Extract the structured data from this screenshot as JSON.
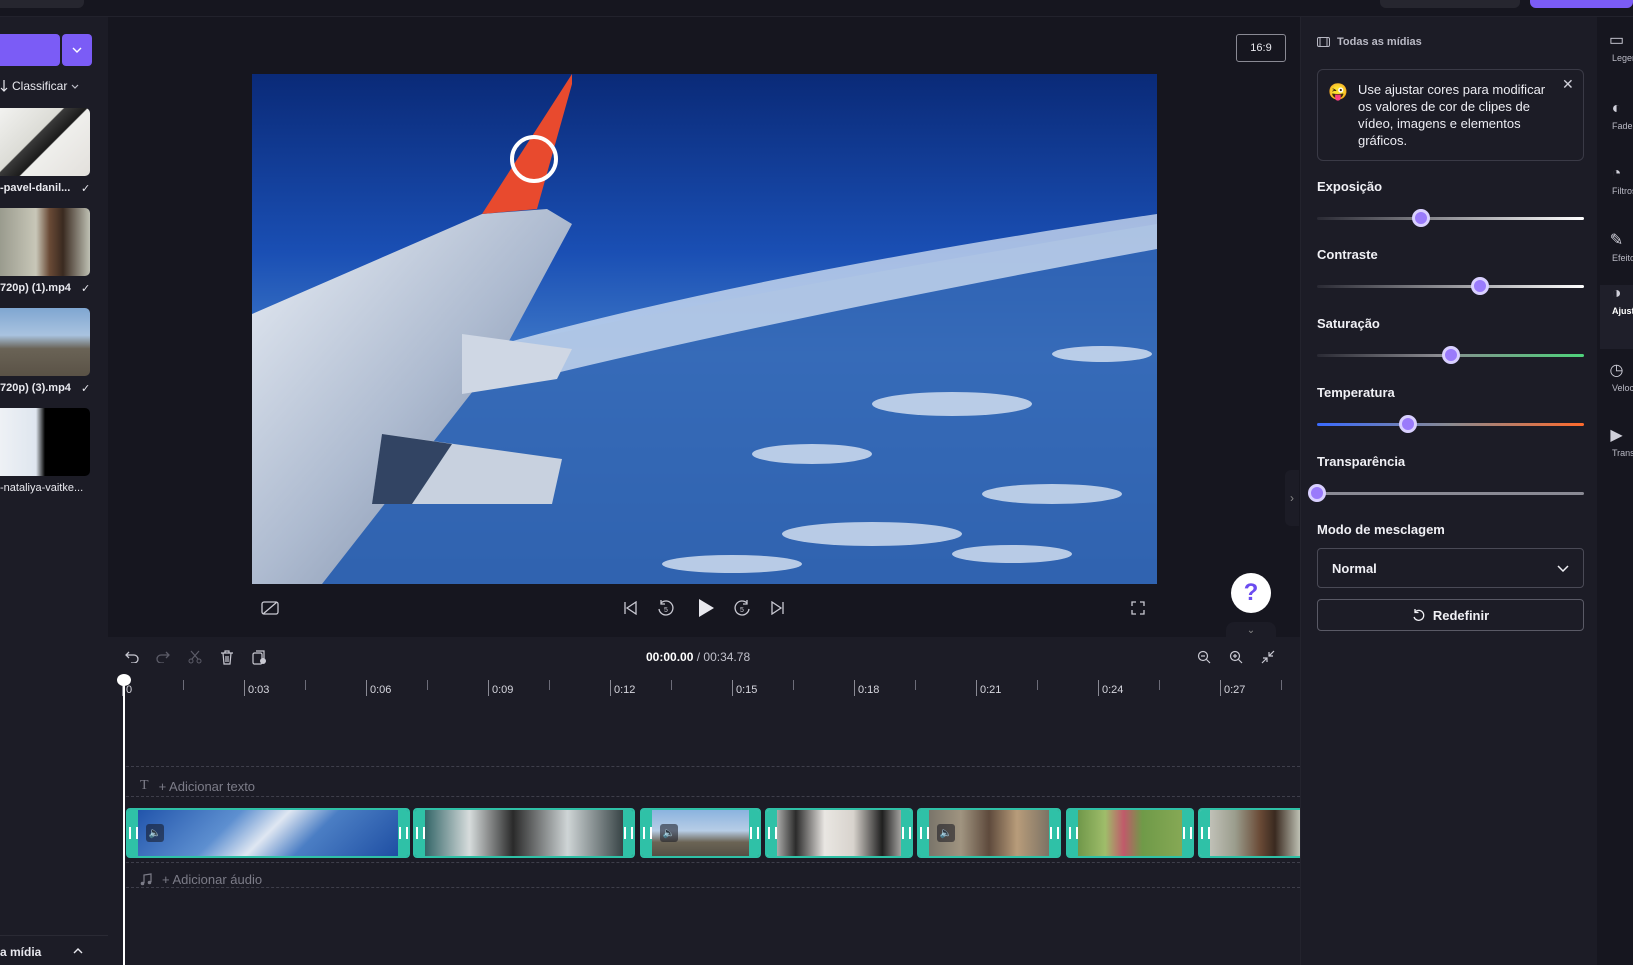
{
  "left_panel": {
    "sort_label": "Classificar",
    "media_items": [
      {
        "label": "-pavel-danil...",
        "check": "✓"
      },
      {
        "label": "720p) (1).mp4",
        "check": "✓"
      },
      {
        "label": "720p) (3).mp4",
        "check": "✓"
      },
      {
        "label": "-nataliya-vaitke...",
        "check": ""
      }
    ],
    "bottom_label": "a mídia"
  },
  "preview": {
    "aspect_ratio": "16:9",
    "help_label": "?"
  },
  "timeline": {
    "current_time": "00:00.00",
    "separator": "/",
    "total_time": "00:34.78",
    "ruler_labels": [
      "0",
      "0:03",
      "0:06",
      "0:09",
      "0:12",
      "0:15",
      "0:18",
      "0:21",
      "0:24",
      "0:27"
    ],
    "add_text": "+ Adicionar texto",
    "add_audio": "+ Adicionar áudio"
  },
  "right_panel": {
    "header": "Todas as mídias",
    "tip_text": "Use ajustar cores para modificar os valores de cor de clipes de vídeo, imagens e elementos gráficos.",
    "sliders": [
      {
        "label": "Exposição",
        "value": 0.39
      },
      {
        "label": "Contraste",
        "value": 0.61
      },
      {
        "label": "Saturação",
        "value": 0.5
      },
      {
        "label": "Temperatura",
        "value": 0.34
      },
      {
        "label": "Transparência",
        "value": 0.0
      }
    ],
    "blend_mode_label": "Modo de mesclagem",
    "blend_mode_value": "Normal",
    "reset_label": "Redefinir"
  },
  "rail": [
    {
      "label": "Legenda"
    },
    {
      "label": "Fade"
    },
    {
      "label": "Filtros"
    },
    {
      "label": "Efeitos"
    },
    {
      "label": "Ajustar cores"
    },
    {
      "label": "Velocidade"
    },
    {
      "label": "Transição"
    }
  ],
  "colors": {
    "accent": "#7b5cf6",
    "clip_border": "#2fc1a7",
    "background": "#16161f",
    "panel": "#1c1c26"
  }
}
